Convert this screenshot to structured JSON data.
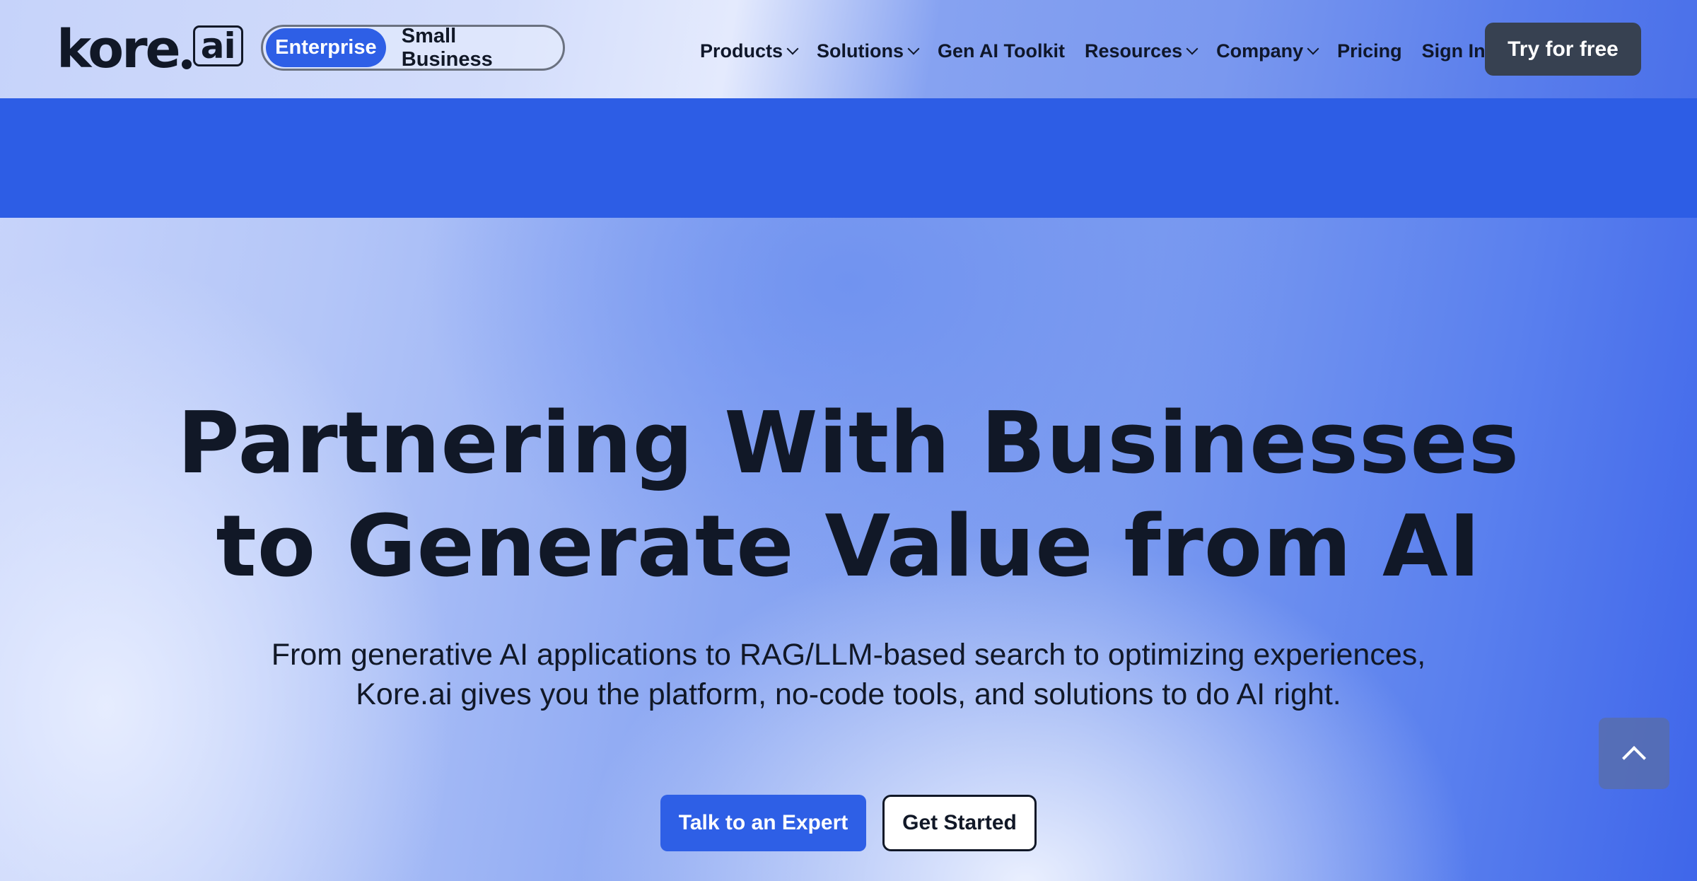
{
  "header": {
    "logo": {
      "wordmark": "kore",
      "suffix": "ai"
    },
    "audience_toggle": {
      "options": [
        {
          "label": "Enterprise",
          "active": true
        },
        {
          "label": "Small Business",
          "active": false
        }
      ]
    },
    "nav": [
      {
        "label": "Products",
        "icon": "chevron-down-icon"
      },
      {
        "label": "Solutions",
        "icon": "chevron-down-icon"
      },
      {
        "label": "Gen AI Toolkit",
        "icon": null
      },
      {
        "label": "Resources",
        "icon": "chevron-down-icon"
      },
      {
        "label": "Company",
        "icon": "chevron-down-icon"
      },
      {
        "label": "Pricing",
        "icon": null
      },
      {
        "label": "Sign In",
        "icon": "chevron-right-icon"
      }
    ],
    "cta_label": "Try for free"
  },
  "hero": {
    "title_lines": [
      "Partnering With Businesses",
      "to Generate Value from AI"
    ],
    "subtitle_lines": [
      "From generative AI applications to RAG/LLM-based search to optimizing experiences,",
      "Kore.ai gives you the platform, no-code tools, and solutions to do AI right."
    ],
    "primary_button": "Talk to an Expert",
    "secondary_button": "Get Started"
  },
  "scroll_top": {
    "icon": "chevron-up-icon"
  },
  "colors": {
    "brand_blue": "#2e5fe6",
    "band_blue": "#2d5de5",
    "dark_button": "#374151",
    "text": "#111827"
  }
}
